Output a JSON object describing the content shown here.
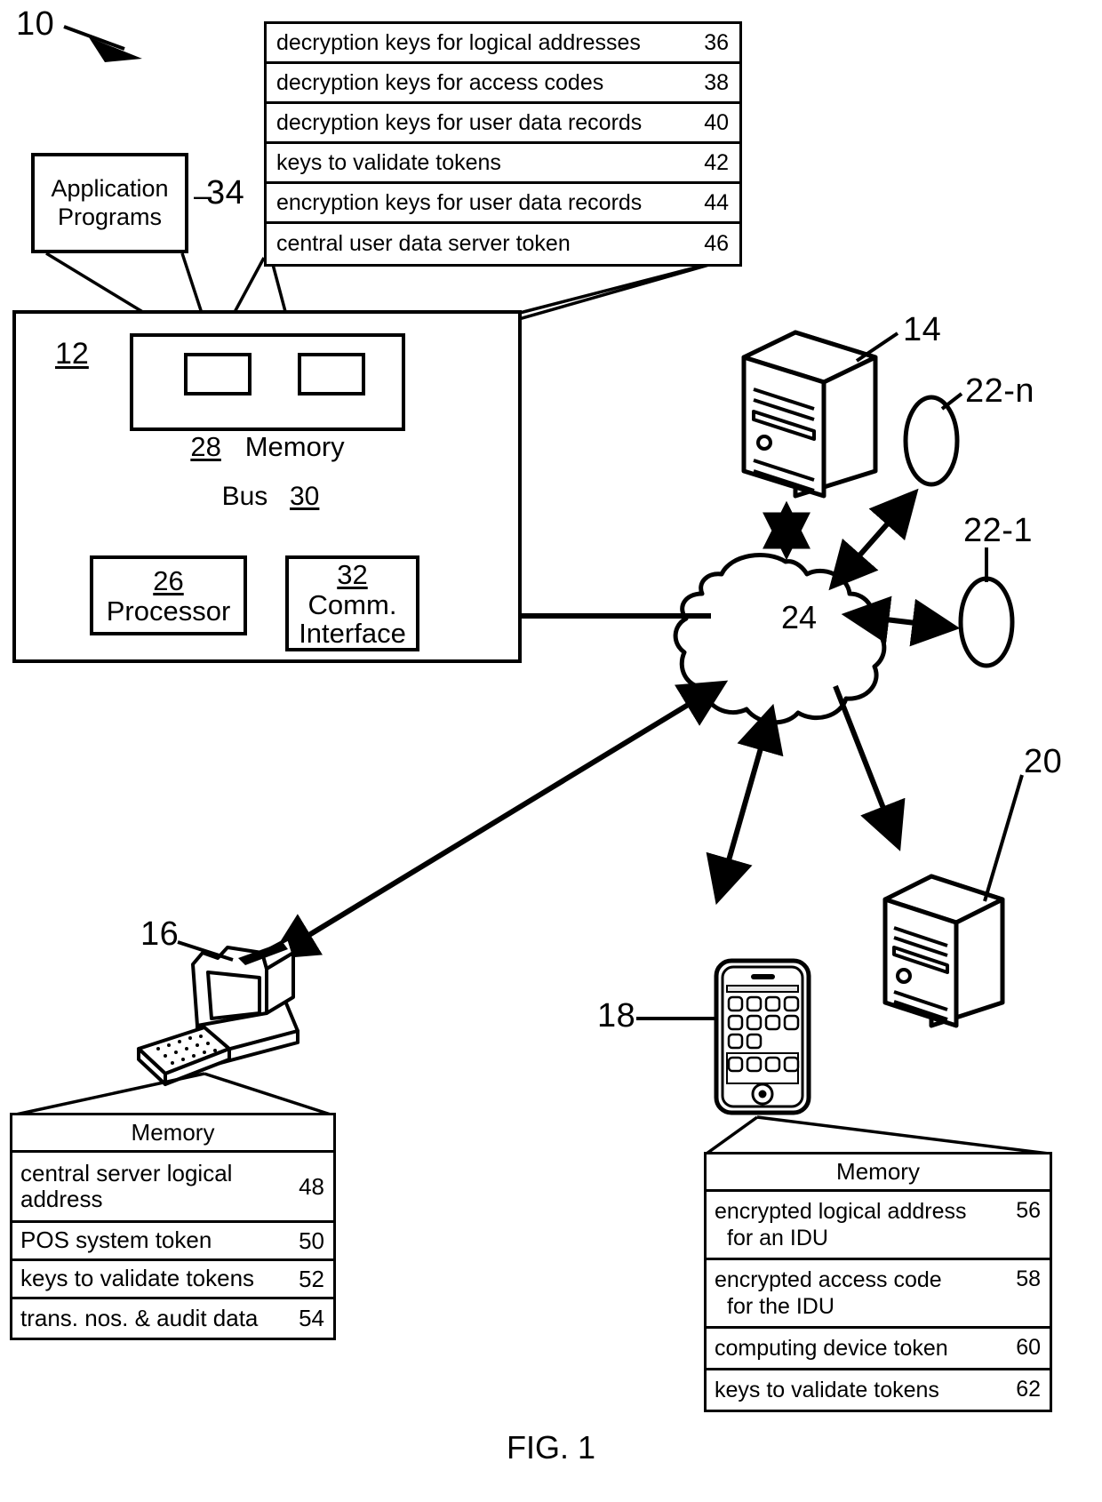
{
  "figure": {
    "caption": "FIG. 1",
    "system_ref": "10"
  },
  "app_box": {
    "line1": "Application",
    "line2": "Programs",
    "ref": "34"
  },
  "key_table": {
    "rows": [
      {
        "label": "decryption keys for logical addresses",
        "num": "36"
      },
      {
        "label": "decryption keys for access codes",
        "num": "38"
      },
      {
        "label": "decryption keys for user data records",
        "num": "40"
      },
      {
        "label": "keys to validate tokens",
        "num": "42"
      },
      {
        "label": "encryption keys for user data records",
        "num": "44"
      },
      {
        "label": "central user data server token",
        "num": "46"
      }
    ]
  },
  "system_box": {
    "ref": "12",
    "memory": {
      "num": "28",
      "label": "Memory"
    },
    "bus": {
      "label": "Bus",
      "num": "30"
    },
    "processor": {
      "num": "26",
      "label": "Processor"
    },
    "comm": {
      "num": "32",
      "label_line1": "Comm.",
      "label_line2": "Interface"
    }
  },
  "network": {
    "cloud_ref": "24",
    "central_server_ref": "14",
    "data_server_ref": "20",
    "terminal_n_ref": "22-n",
    "terminal_1_ref": "22-1",
    "pos_computer_ref": "16",
    "mobile_device_ref": "18"
  },
  "pos_memory": {
    "header": "Memory",
    "rows": [
      {
        "label": "central server logical address",
        "num": "48",
        "tall": true
      },
      {
        "label": "POS system token",
        "num": "50",
        "tall": false
      },
      {
        "label": "keys to validate tokens",
        "num": "52",
        "tall": false
      },
      {
        "label": "trans. nos. & audit data",
        "num": "54",
        "tall": false
      }
    ]
  },
  "device_memory": {
    "header": "Memory",
    "rows": [
      {
        "line1": "encrypted logical address",
        "line2": "for an IDU",
        "num": "56"
      },
      {
        "line1": "encrypted access code",
        "line2": "for the IDU",
        "num": "58"
      },
      {
        "line1": "computing device token",
        "line2": "",
        "num": "60"
      },
      {
        "line1": "keys to validate tokens",
        "line2": "",
        "num": "62"
      }
    ]
  },
  "colors": {
    "ink": "#000000",
    "paper": "#ffffff"
  }
}
